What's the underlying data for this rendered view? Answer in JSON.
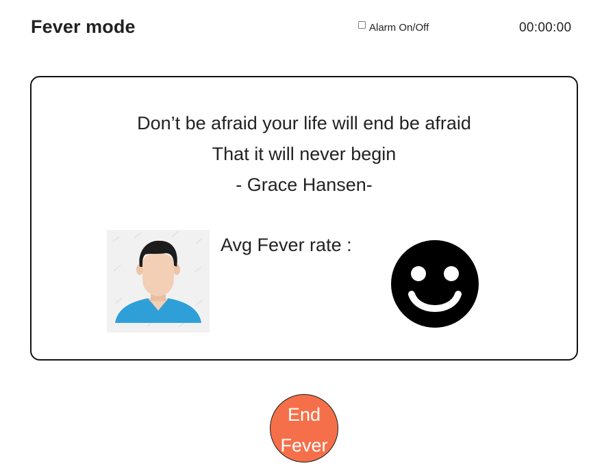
{
  "header": {
    "title": "Fever mode",
    "alarm_label": "Alarm On/Off",
    "alarm_checked": false,
    "timer": "00:00:00"
  },
  "card": {
    "quote_lines": [
      "Don’t be afraid your life will end be afraid",
      "That it will never begin",
      "- Grace Hansen-"
    ],
    "avg_label": "Avg Fever rate :",
    "avatar_icon": "user-avatar-icon",
    "mood_icon": "smiley-face-icon"
  },
  "end_button": {
    "line1": "End",
    "line2": "Fever",
    "color": "#f5704a"
  }
}
